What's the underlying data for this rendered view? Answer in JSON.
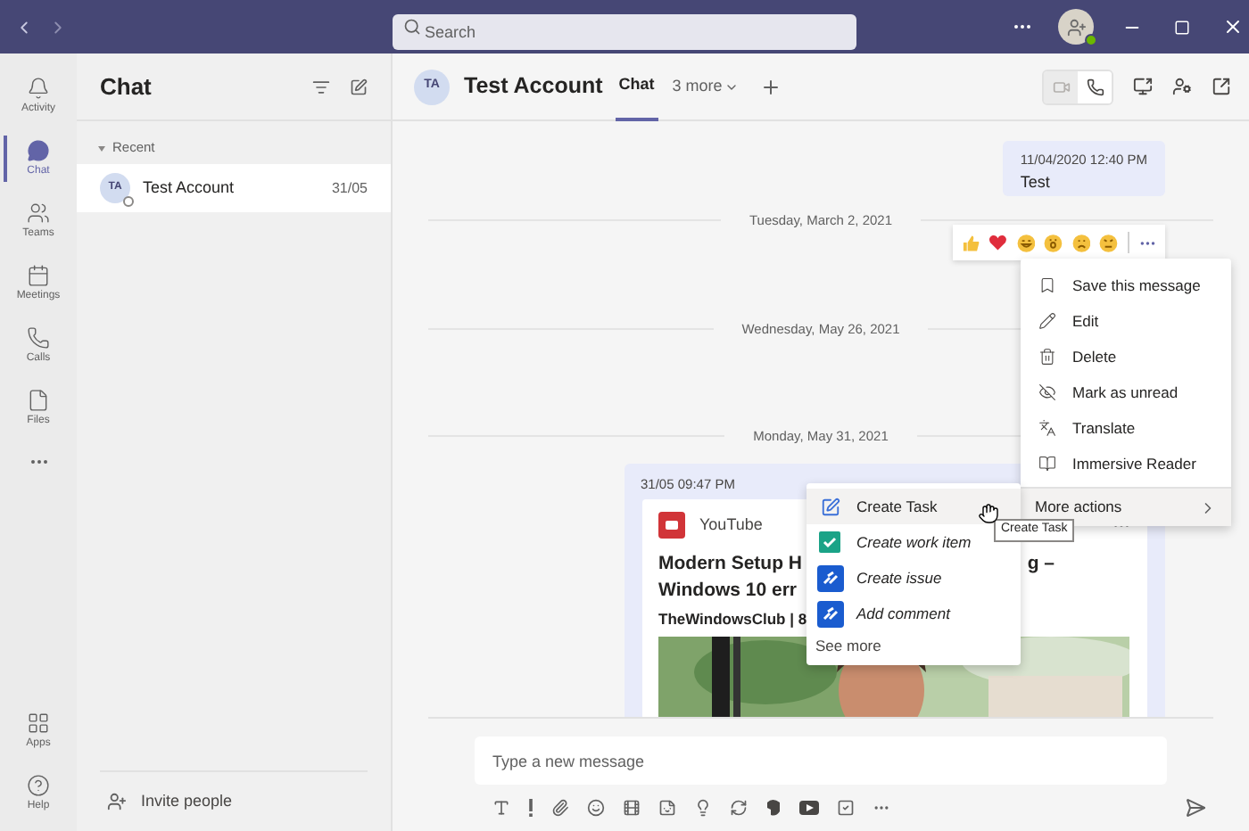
{
  "title_bar": {
    "search": {
      "placeholder": "Search"
    }
  },
  "rail": {
    "items": [
      {
        "label": "Activity",
        "selected": false
      },
      {
        "label": "Chat",
        "selected": true
      },
      {
        "label": "Teams",
        "selected": false
      },
      {
        "label": "Meetings",
        "selected": false
      },
      {
        "label": "Calls",
        "selected": false
      },
      {
        "label": "Files",
        "selected": false
      }
    ],
    "bottom_items": [
      {
        "label": "Apps",
        "selected": false
      },
      {
        "label": "Help",
        "selected": false
      }
    ]
  },
  "chat_list": {
    "title": "Chat",
    "section": {
      "label": "Recent",
      "expanded": true
    },
    "items": [
      {
        "avatar": "TA",
        "name": "Test Account",
        "date": "31/05",
        "selected": true
      }
    ],
    "invite": "Invite people"
  },
  "conversation": {
    "avatar": "TA",
    "name": "Test Account",
    "tabs": [
      {
        "label": "Chat",
        "selected": true
      }
    ],
    "more_tabs": "3 more",
    "messages": [
      {
        "kind": "bubble",
        "time": "11/04/2020 12:40 PM",
        "text": "Test"
      },
      {
        "kind": "date",
        "text": "Tuesday, March 2, 2021"
      },
      {
        "kind": "date",
        "text": "Wednesday, May 26, 2021"
      },
      {
        "kind": "date",
        "text": "Monday, May 31, 2021"
      },
      {
        "kind": "card",
        "time": "31/05 09:47 PM",
        "source": "YouTube",
        "title_start": "Modern Setup H",
        "title_end": "g –",
        "title_line_2": "Windows 10 err",
        "byline": "TheWindowsClub | 8"
      }
    ]
  },
  "context_menu": {
    "items": [
      {
        "label": "Save this message",
        "selected": false
      },
      {
        "label": "Edit",
        "selected": false
      },
      {
        "label": "Delete",
        "selected": false
      },
      {
        "label": "Mark as unread",
        "selected": false
      },
      {
        "label": "Translate",
        "selected": false
      },
      {
        "label": "Immersive Reader",
        "selected": false
      }
    ],
    "more_actions": {
      "label": "More actions",
      "selected": true
    }
  },
  "submenu": {
    "items": [
      {
        "label": "Create Task",
        "kind": "tasks",
        "selected": true
      },
      {
        "label": "Create work item",
        "kind": "devops",
        "selected": false
      },
      {
        "label": "Create issue",
        "kind": "jira",
        "selected": false
      },
      {
        "label": "Add comment",
        "kind": "jira",
        "selected": false
      }
    ],
    "see_more": "See more"
  },
  "tooltip": "Create Task",
  "composer": {
    "placeholder": "Type a new message"
  }
}
